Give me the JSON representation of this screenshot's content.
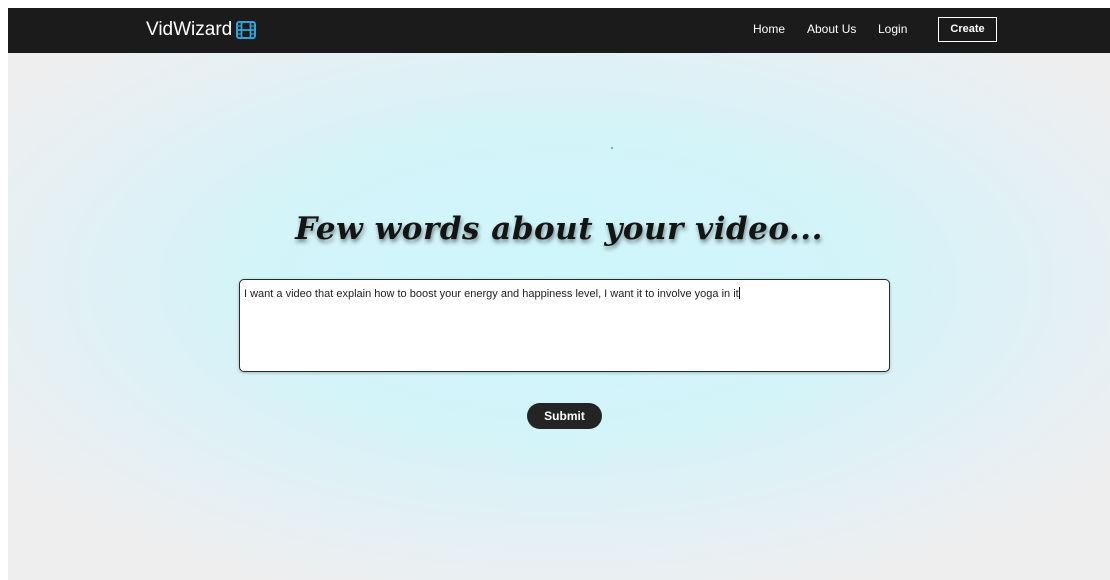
{
  "navbar": {
    "brand": "VidWizard",
    "brand_icon": "film-icon",
    "brand_icon_color": "#2fa4d8",
    "links": [
      "Home",
      "About Us",
      "Login"
    ],
    "create_label": "Create"
  },
  "main": {
    "headline": "Few words about your video...",
    "prompt_value": "I want a video that explain how to boost your energy and happiness level, I want it to involve yoga in it",
    "submit_label": "Submit"
  },
  "colors": {
    "navbar_bg": "#1b1b1b",
    "background_center": "#cdf6fb",
    "background_edge": "#eeeeef",
    "button_bg": "#242424"
  }
}
